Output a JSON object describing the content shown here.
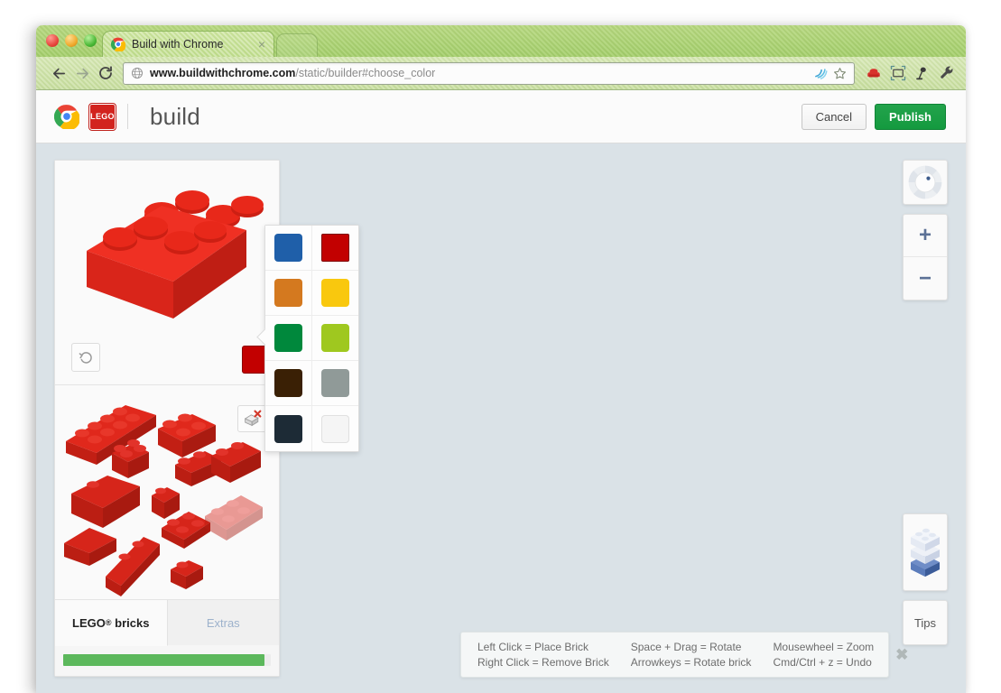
{
  "browser": {
    "tab": {
      "title": "Build with Chrome",
      "favicon": "chrome-icon",
      "close": "×"
    },
    "nav": {
      "back": "←",
      "forward": "→",
      "reload": "⟳"
    },
    "omnibox": {
      "scheme_host": "www.buildwithchrome.com",
      "path": "/static/builder#choose_color",
      "security_icon": "globe-icon",
      "bookmark_icon": "star-icon",
      "sync_icon": "wave-icon"
    },
    "extensions": [
      "sofa-icon",
      "screenshot-icon",
      "lamp-icon",
      "wrench-icon"
    ]
  },
  "app": {
    "brand": {
      "chrome_logo": "chrome-icon",
      "lego_logo": "LEGO",
      "word": "build"
    },
    "actions": {
      "cancel": "Cancel",
      "publish": "Publish"
    }
  },
  "left_panel": {
    "preview": {
      "brick_name": "red-2x4-brick",
      "rotate_label": "rotate-icon",
      "current_color": "#c20000"
    },
    "tray": {
      "trash_label": "delete-brick-icon",
      "bricks": [
        "brick-2x8",
        "brick-2x4",
        "brick-2x2",
        "brick-1x4",
        "brick-slope-large",
        "brick-1x6",
        "brick-1x1",
        "brick-wedge",
        "brick-plate-2x2",
        "brick-plate-2x4-trans",
        "brick-1x6b",
        "brick-plate-1x1"
      ]
    },
    "tabs": [
      {
        "label": "LEGO",
        "sup": "®",
        "label2": "bricks",
        "active": true
      },
      {
        "label": "Extras",
        "active": false
      }
    ],
    "progress": {
      "percent": 97,
      "color": "#5cb85c"
    }
  },
  "palette": {
    "colors": [
      {
        "name": "blue",
        "hex": "#1f5fa9",
        "selected": false
      },
      {
        "name": "red",
        "hex": "#c20000",
        "selected": true
      },
      {
        "name": "orange",
        "hex": "#d4791f",
        "selected": false
      },
      {
        "name": "yellow",
        "hex": "#f9c80e",
        "selected": false
      },
      {
        "name": "green",
        "hex": "#00883c",
        "selected": false
      },
      {
        "name": "lime",
        "hex": "#9fc81f",
        "selected": false
      },
      {
        "name": "brown",
        "hex": "#3a2005",
        "selected": false
      },
      {
        "name": "gray",
        "hex": "#909a98",
        "selected": false
      },
      {
        "name": "navy",
        "hex": "#1d2b36",
        "selected": false
      },
      {
        "name": "white",
        "hex": "#f5f5f5",
        "selected": false
      }
    ]
  },
  "controls": {
    "dpad": "rotate-view-control",
    "zoom_in": "+",
    "zoom_out": "−",
    "height_indicator": "brick-height-indicator",
    "tips_button": "Tips"
  },
  "tips": {
    "columns": [
      [
        "Left Click = Place Brick",
        "Right Click = Remove Brick"
      ],
      [
        "Space + Drag = Rotate",
        "Arrowkeys = Rotate brick"
      ],
      [
        "Mousewheel = Zoom",
        "Cmd/Ctrl + z = Undo"
      ]
    ],
    "close": "✖"
  },
  "theme": {
    "canvas_bg": "#dae2e7",
    "publish_green": "#169a3f",
    "brick_red": "#d2231e"
  }
}
